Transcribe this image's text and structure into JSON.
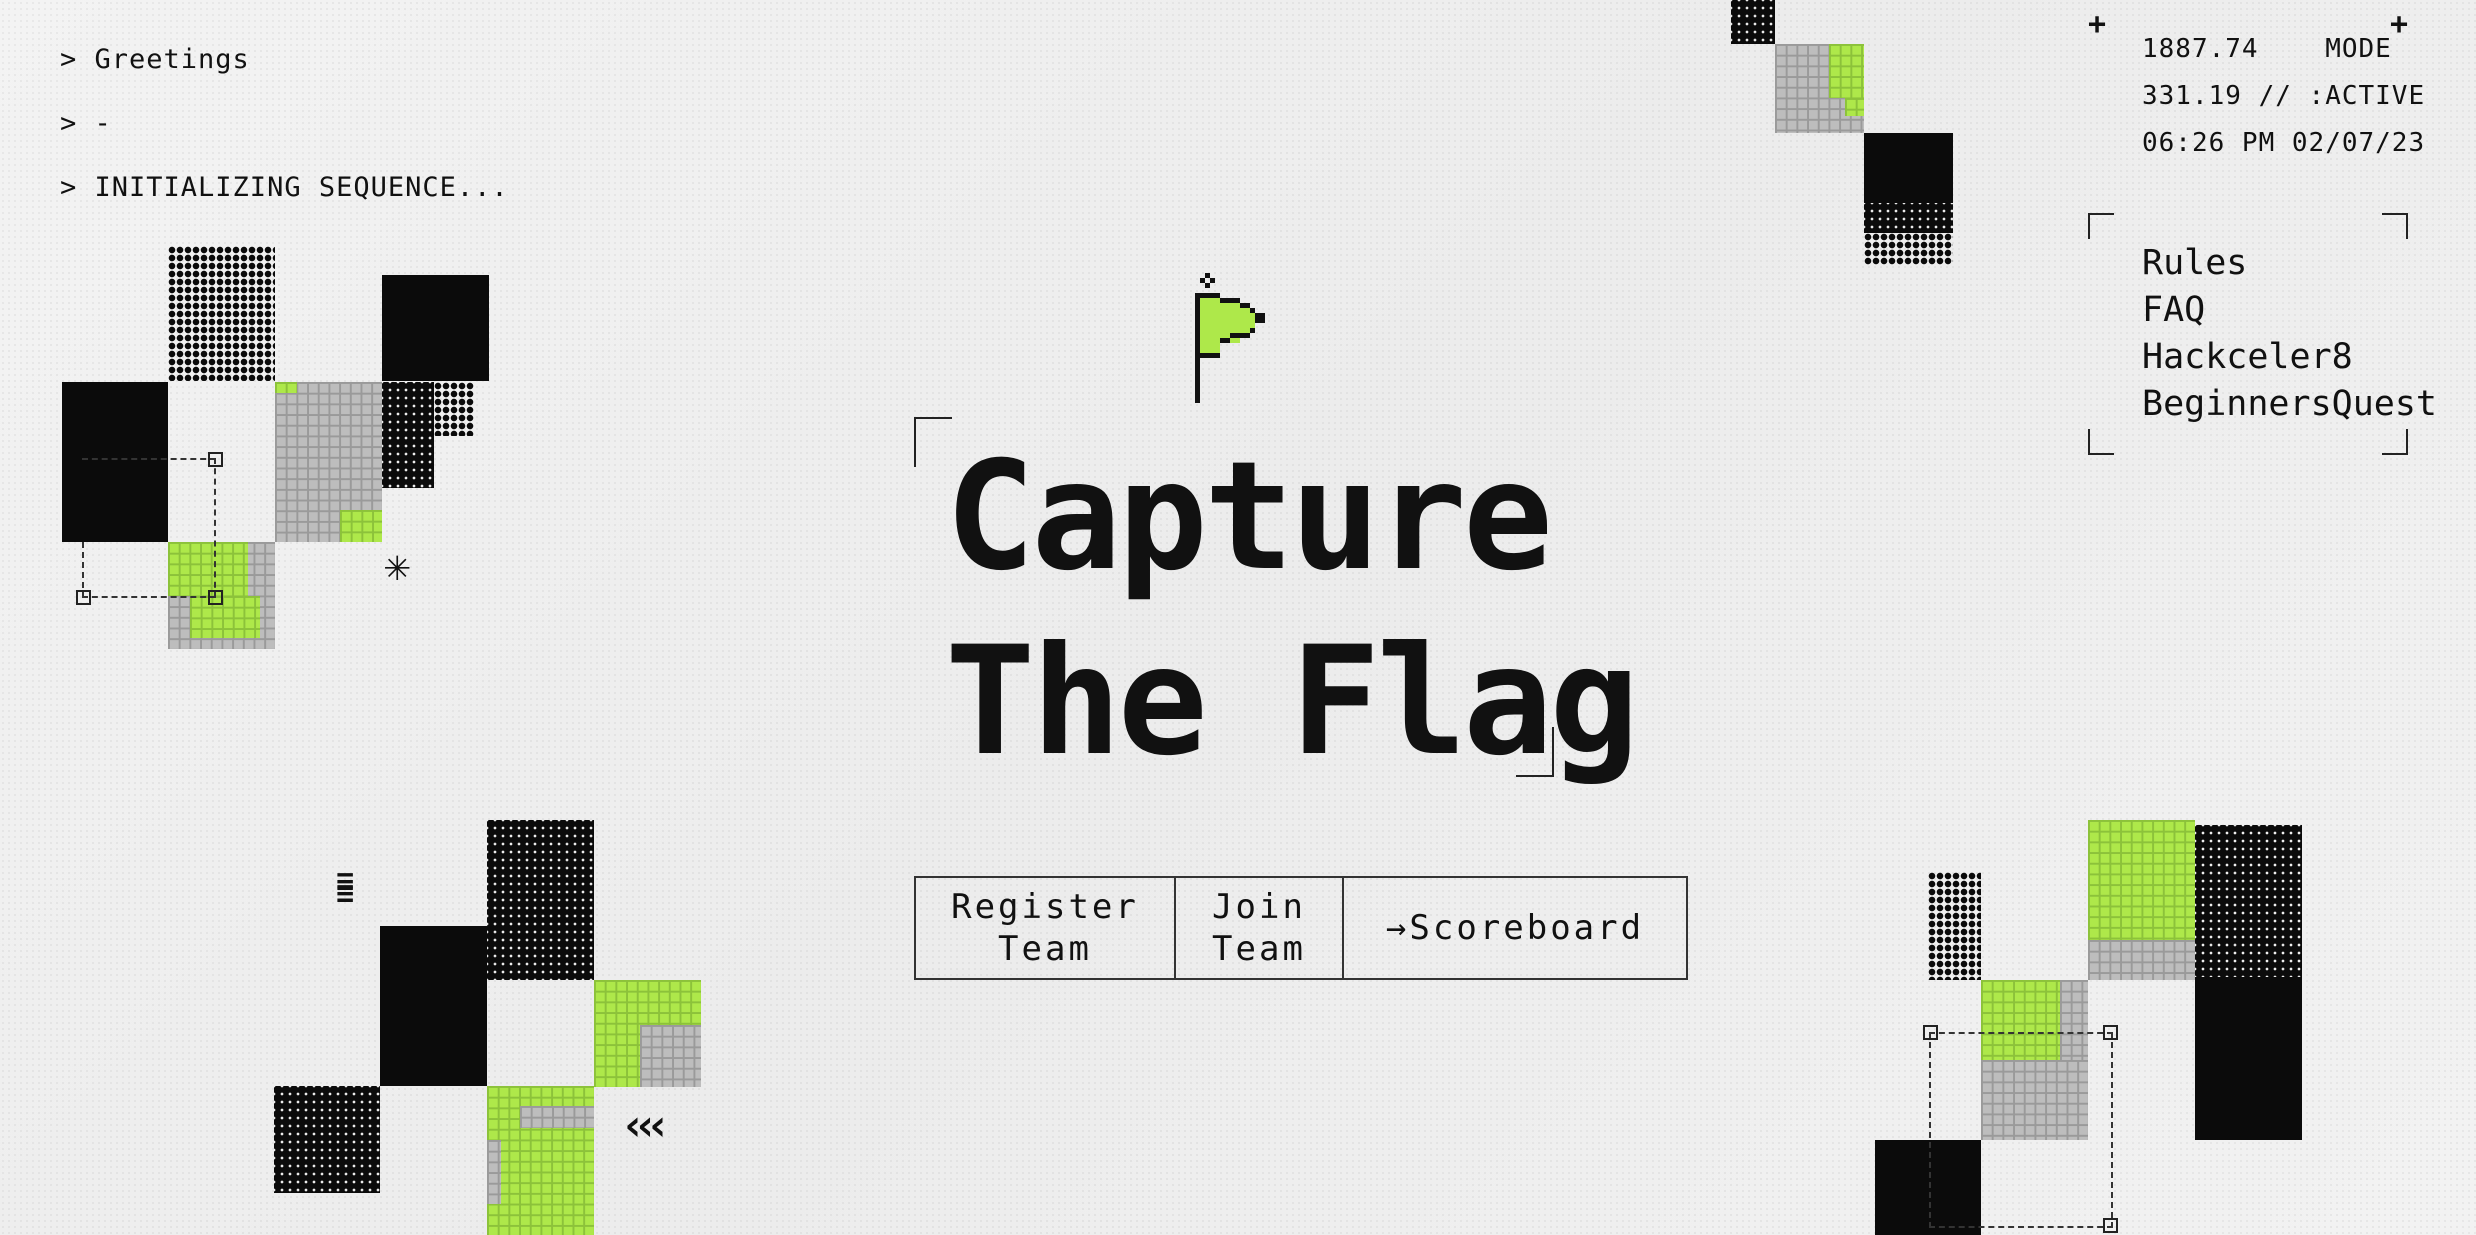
{
  "terminal": {
    "lines": [
      "> Greetings",
      "> -",
      "> INITIALIZING SEQUENCE..."
    ]
  },
  "status": {
    "coord_x": "1887.74",
    "mode_label": "MODE",
    "coord_y": "331.19",
    "mode_value": "// :ACTIVE",
    "time": "06:26 PM",
    "date": "02/07/23"
  },
  "nav": {
    "items": [
      {
        "label": "Rules"
      },
      {
        "label": "FAQ"
      },
      {
        "label": "Hackceler8"
      },
      {
        "label": "BeginnersQuest"
      }
    ]
  },
  "hero": {
    "title_line1": "Capture",
    "title_line2": "The Flag",
    "icon": "flag-icon"
  },
  "actions": {
    "register_line1": "Register",
    "register_line2": "Team",
    "join_line1": "Join",
    "join_line2": "Team",
    "scoreboard": "→Scoreboard"
  },
  "decor": {
    "icons": [
      "asterisk-icon",
      "double-chevron-left-icon",
      "dashed-lines-icon"
    ],
    "accent_color": "#aee84a",
    "tile_grey": "#bdbdbd",
    "tile_black": "#0b0b0b"
  }
}
